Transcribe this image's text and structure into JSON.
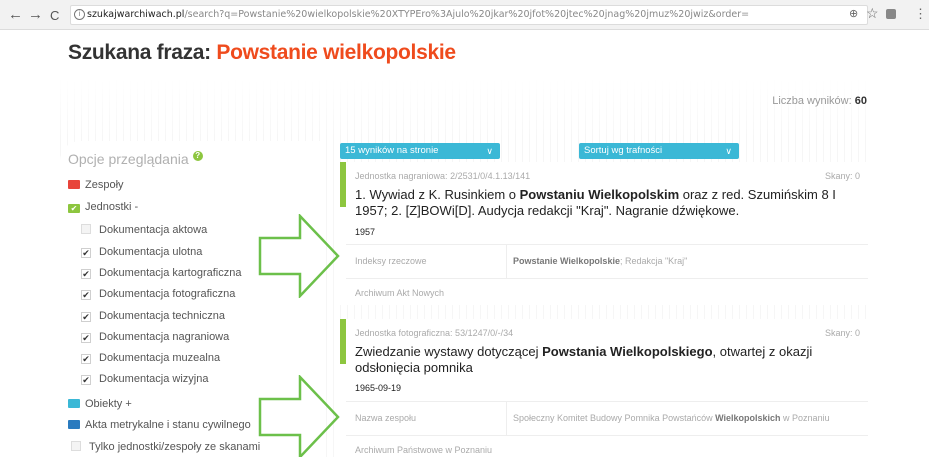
{
  "browser": {
    "back": "←",
    "forward": "→",
    "reload": "C",
    "url_domain": "szukajwarchiwach.pl",
    "url_rest": "/search?q=Powstanie%20wielkopolskie%20XTYPEro%3Ajulo%20jkar%20jfot%20jtec%20jnag%20jmuz%20jwiz&order="
  },
  "page": {
    "title_label": "Szukana fraza: ",
    "title_phrase": "Powstanie wielkopolskie",
    "results_label": "Liczba wyników:",
    "results_count": "60"
  },
  "toolbar": {
    "per_page": "15 wyników na stronie",
    "sort": "Sortuj wg trafności"
  },
  "sidebar": {
    "title": "Opcje przeglądania",
    "zespoly": "Zespoły",
    "jednostki": "Jednostki -",
    "items": [
      {
        "label": "Dokumentacja aktowa",
        "checked": false
      },
      {
        "label": "Dokumentacja ulotna",
        "checked": true
      },
      {
        "label": "Dokumentacja kartograficzna",
        "checked": true
      },
      {
        "label": "Dokumentacja fotograficzna",
        "checked": true
      },
      {
        "label": "Dokumentacja techniczna",
        "checked": true
      },
      {
        "label": "Dokumentacja nagraniowa",
        "checked": true
      },
      {
        "label": "Dokumentacja muzealna",
        "checked": true
      },
      {
        "label": "Dokumentacja wizyjna",
        "checked": true
      }
    ],
    "obiekty": "Obiekty +",
    "akta": "Akta metrykalne i stanu cywilnego",
    "skany": "Tylko jednostki/zespoły ze skanami",
    "colors": {
      "zespoly": "#e8443a",
      "jednostki": "#8dc63f",
      "obiekty": "#3bb8d6",
      "akta": "#2a7bbf"
    }
  },
  "results": [
    {
      "meta": "Jednostka nagraniowa: 2/2531/0/4.1.13/141",
      "scans": "Skany: 0",
      "title_pre": "1. Wywiad z K. Rusinkiem o ",
      "title_hl": "Powstaniu Wielkopolskim",
      "title_post": " oraz z red. Szumińskim 8 I 1957; 2. [Z]BOWi[D]. Audycja redakcji \"Kraj\". Nagranie dźwiękowe.",
      "date": "1957",
      "row1_label": "Indeksy rzeczowe",
      "row1_hl": "Powstanie Wielkopolskie",
      "row1_rest": "; Redakcja \"Kraj\"",
      "row2_label": "Archiwum Akt Nowych"
    },
    {
      "meta": "Jednostka fotograficzna: 53/1247/0/-/34",
      "scans": "Skany: 0",
      "title_pre": "Zwiedzanie wystawy dotyczącej ",
      "title_hl": "Powstania Wielkopolskiego",
      "title_post": ", otwartej z okazji odsłonięcia pomnika",
      "date": "1965-09-19",
      "row1_label": "Nazwa zespołu",
      "row1_pre": "Społeczny Komitet Budowy Pomnika Powstańców ",
      "row1_hl": "Wielkopolskich",
      "row1_rest": " w Poznaniu",
      "row2_label": "Archiwum Państwowe w Poznaniu"
    }
  ],
  "accent_color": "#ef4b1d",
  "arrow_color": "#6cc04a"
}
